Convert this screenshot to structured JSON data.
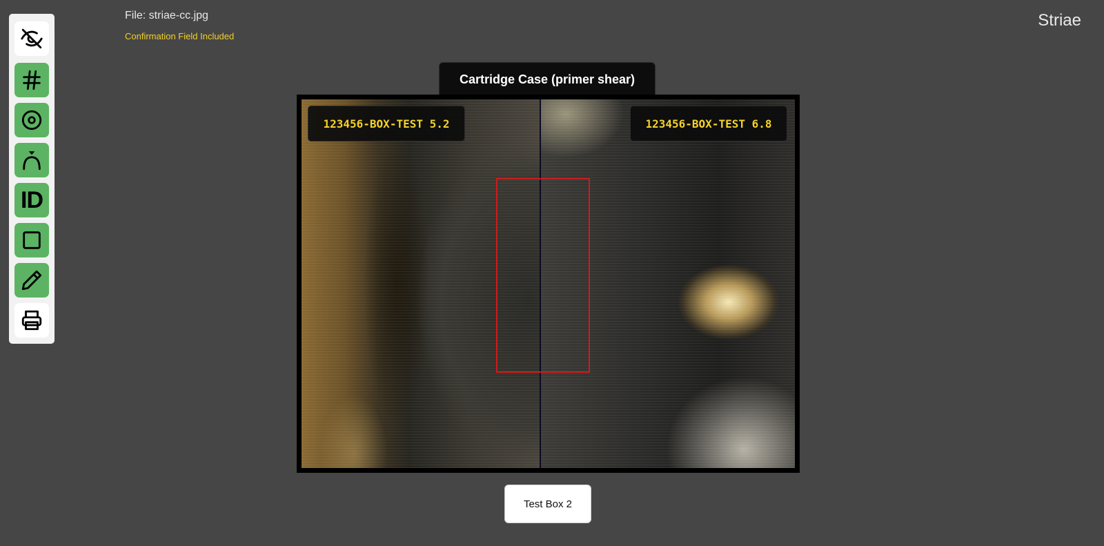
{
  "header": {
    "file_name": "File: striae-cc.jpg",
    "confirmation_note": "Confirmation Field Included",
    "app_title": "Striae"
  },
  "toolbar": {
    "tools": [
      {
        "icon": "eye-off-icon",
        "state": "inactive"
      },
      {
        "icon": "hash-icon",
        "state": "active"
      },
      {
        "icon": "target-icon",
        "state": "active"
      },
      {
        "icon": "arc-marker-icon",
        "state": "active"
      },
      {
        "icon": "id-icon",
        "label": "ID",
        "state": "active"
      },
      {
        "icon": "square-icon",
        "state": "active"
      },
      {
        "icon": "pencil-icon",
        "state": "active"
      },
      {
        "icon": "printer-icon",
        "state": "inactive"
      }
    ],
    "active_color": "#5cb363"
  },
  "comparison": {
    "case_title": "Cartridge Case (primer shear)",
    "left_label": "123456-BOX-TEST 5.2",
    "right_label": "123456-BOX-TEST 6.8",
    "box_label": "Test Box 2",
    "label_color": "#f4d22b",
    "selection_color": "#d01a1a"
  }
}
